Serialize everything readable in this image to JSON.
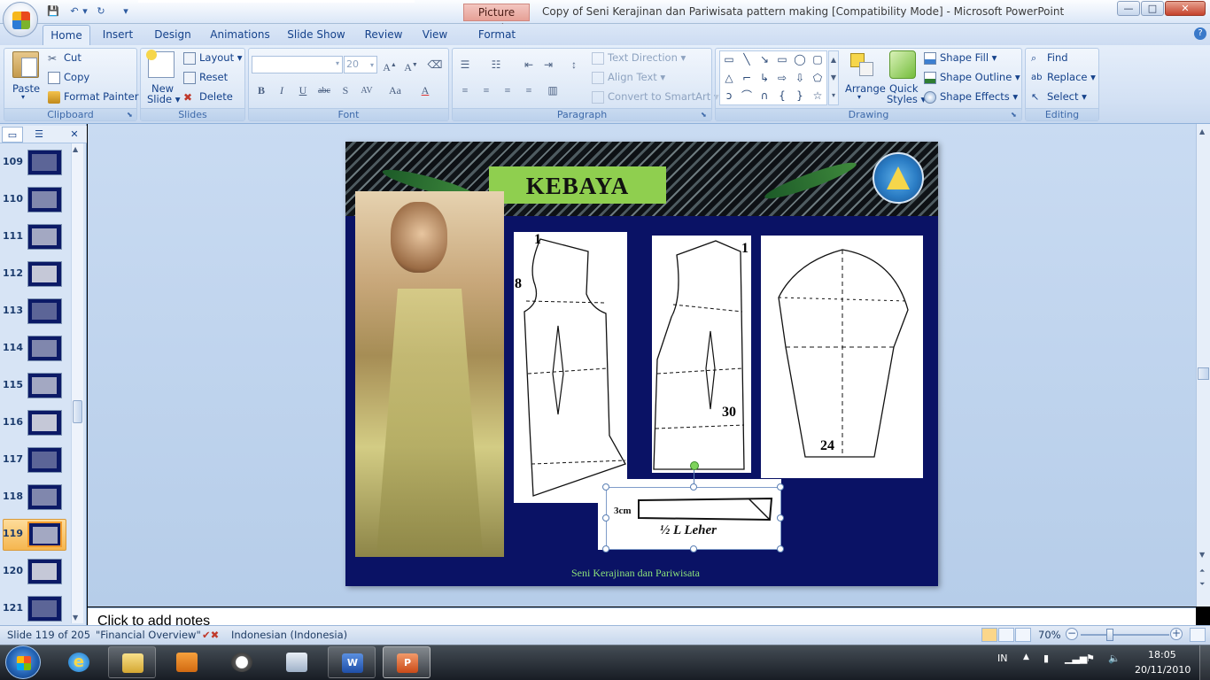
{
  "window": {
    "contextual_tab": "Picture Tools",
    "title": "Copy of Seni Kerajinan dan Pariwisata pattern making [Compatibility Mode] - Microsoft PowerPoint",
    "minimize": "—",
    "maximize": "□",
    "close": "✕"
  },
  "tabs": [
    "Home",
    "Insert",
    "Design",
    "Animations",
    "Slide Show",
    "Review",
    "View",
    "Format"
  ],
  "clipboard": {
    "paste": "Paste",
    "cut": "Cut",
    "copy": "Copy",
    "format_painter": "Format Painter",
    "label": "Clipboard"
  },
  "slides": {
    "new_slide_line1": "New",
    "new_slide_line2": "Slide",
    "layout": "Layout",
    "reset": "Reset",
    "delete": "Delete",
    "label": "Slides"
  },
  "font": {
    "name": "",
    "size": "20",
    "label": "Font"
  },
  "paragraph": {
    "text_direction": "Text Direction",
    "align_text": "Align Text",
    "convert_smartart": "Convert to SmartArt",
    "label": "Paragraph"
  },
  "drawing": {
    "arrange": "Arrange",
    "quick_styles_line1": "Quick",
    "quick_styles_line2": "Styles",
    "shape_fill": "Shape Fill",
    "shape_outline": "Shape Outline",
    "shape_effects": "Shape Effects",
    "label": "Drawing"
  },
  "editing": {
    "find": "Find",
    "replace": "Replace",
    "select": "Select",
    "label": "Editing"
  },
  "thumbnails": [
    {
      "num": "109"
    },
    {
      "num": "110"
    },
    {
      "num": "111"
    },
    {
      "num": "112"
    },
    {
      "num": "113"
    },
    {
      "num": "114"
    },
    {
      "num": "115"
    },
    {
      "num": "116"
    },
    {
      "num": "117"
    },
    {
      "num": "118"
    },
    {
      "num": "119",
      "selected": true
    },
    {
      "num": "120"
    },
    {
      "num": "121"
    }
  ],
  "slide": {
    "title": "KEBAYA",
    "labels": {
      "front_top": "1",
      "front_side": "8",
      "back_top": "1",
      "back_bottom": "30",
      "sleeve_bottom": "24"
    },
    "collar_size": "3cm",
    "collar_text": "½ L Leher",
    "footer": "Seni Kerajinan dan Pariwisata",
    "background_color": "#0a1265",
    "title_box_color": "#8fcf4f"
  },
  "notes": {
    "placeholder": "Click to add notes"
  },
  "status": {
    "slide_info": "Slide 119 of 205",
    "theme": "\"Financial Overview\"",
    "language": "Indonesian (Indonesia)",
    "zoom": "70%"
  },
  "tray": {
    "lang": "IN",
    "time": "18:05",
    "date": "20/11/2010"
  }
}
